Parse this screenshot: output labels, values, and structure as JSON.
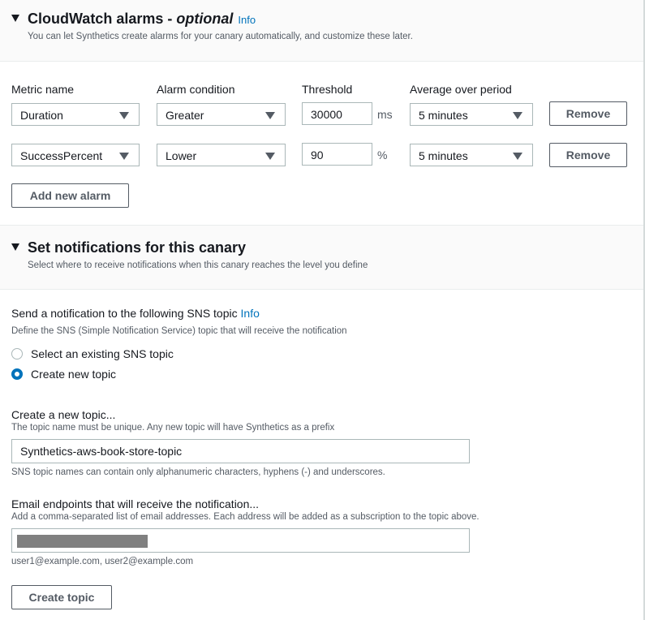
{
  "alarms": {
    "title": "CloudWatch alarms - ",
    "title_optional": "optional",
    "info": "Info",
    "subtitle": "You can let Synthetics create alarms for your canary automatically, and customize these later.",
    "columns": {
      "metric": "Metric name",
      "condition": "Alarm condition",
      "threshold": "Threshold",
      "period": "Average over period"
    },
    "rows": [
      {
        "metric": "Duration",
        "condition": "Greater",
        "threshold": "30000",
        "unit": "ms",
        "period": "5 minutes",
        "remove": "Remove"
      },
      {
        "metric": "SuccessPercent",
        "condition": "Lower",
        "threshold": "90",
        "unit": "%",
        "period": "5 minutes",
        "remove": "Remove"
      }
    ],
    "add_button": "Add new alarm"
  },
  "notifications": {
    "title": "Set notifications for this canary",
    "subtitle": "Select where to receive notifications when this canary reaches the level you define",
    "sns_label": "Send a notification to the following SNS topic",
    "sns_info": "Info",
    "sns_desc": "Define the SNS (Simple Notification Service) topic that will receive the notification",
    "radio_existing": "Select an existing SNS topic",
    "radio_new": "Create new topic",
    "selected": "new",
    "topic_label": "Create a new topic...",
    "topic_desc": "The topic name must be unique. Any new topic will have Synthetics as a prefix",
    "topic_value": "Synthetics-aws-book-store-topic",
    "topic_hint": "SNS topic names can contain only alphanumeric characters, hyphens (-) and underscores.",
    "email_label": "Email endpoints that will receive the notification...",
    "email_desc": "Add a comma-separated list of email addresses. Each address will be added as a subscription to the topic above.",
    "email_hint": "user1@example.com, user2@example.com",
    "create_button": "Create topic"
  }
}
